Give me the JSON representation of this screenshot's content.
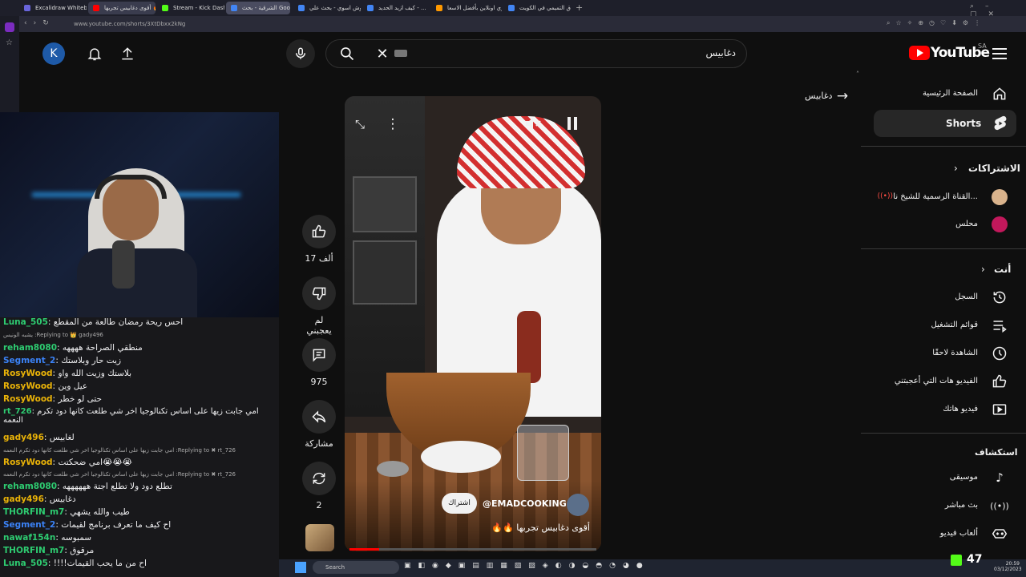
{
  "browser": {
    "tabs": [
      {
        "label": "Excalidraw Whiteboard",
        "color": "#6965db"
      },
      {
        "label": "أقوى دغابيس تجربها 🔥🔥",
        "color": "#ff0000"
      },
      {
        "label": "Stream - Kick Dashboard",
        "color": "#53fc18"
      },
      {
        "label": "الشرقية - بحث Google",
        "color": "#4285f4"
      },
      {
        "label": "وش اسوي - بحث علي",
        "color": "#4285f4"
      },
      {
        "label": "كيف ازيد الحديد - ...",
        "color": "#4285f4"
      },
      {
        "label": "اشتري اونلاين بأفضل الاسعا...",
        "color": "#ff9900"
      },
      {
        "label": "اسواق التميمي في الكويت",
        "color": "#4285f4"
      }
    ],
    "url": "www.youtube.com/shorts/3XtDbxx2kNg"
  },
  "chat": {
    "messages": [
      {
        "user": "Luna_505",
        "text": "احس ريحة رمضان طالعة من المقطع",
        "color": "#2ecc71"
      },
      {
        "reply": "Replying to 👑 gady496: يشبه الونيس"
      },
      {
        "user": "reham8080",
        "text": "منطقي الصراحة ههههه",
        "color": "#2ecc71"
      },
      {
        "user": "Segment_2",
        "text": "زيت حار وبلاستك",
        "color": "#3b82f6"
      },
      {
        "user": "RosyWood",
        "text": "بلاستك وزيت الله واو",
        "color": "#eab308"
      },
      {
        "user": "RosyWood",
        "text": "عيل وين",
        "color": "#eab308"
      },
      {
        "user": "RosyWood",
        "text": "حتى لو خطر",
        "color": "#eab308"
      },
      {
        "user": "rt_726",
        "text": "امي جابت زيها على اساس تكنالوجيا اخر شي طلعت كانها دود تكرم النعمه",
        "color": "#2ecc71"
      },
      {
        "user": "gady496",
        "text": "لغابيس",
        "color": "#eab308"
      },
      {
        "reply": "Replying to ✖ rt_726: امي جابت زيها على اساس تكنالوجيا اخر شي طلعت كانها دود تكرم النعمه"
      },
      {
        "user": "RosyWood",
        "text": "امي ضحكتت😭😭😭",
        "color": "#eab308"
      },
      {
        "reply": "Replying to ✖ rt_726: امي جابت زيها على اساس تكنالوجيا اخر شي طلعت كانها دود تكرم النعمه"
      },
      {
        "user": "reham8080",
        "text": "تطلع دود ولا تطلع اجتة ههههههه",
        "color": "#2ecc71"
      },
      {
        "user": "gady496",
        "text": "دغابيس",
        "color": "#eab308"
      },
      {
        "user": "THORFIN_m7",
        "text": "طيب والله يشهي",
        "color": "#2ecc71"
      },
      {
        "user": "Segment_2",
        "text": "اح كيف ما تعرف برنامج لقيمات",
        "color": "#3b82f6"
      },
      {
        "user": "nawaf154n",
        "text": "سمبوسه",
        "color": "#2ecc71"
      },
      {
        "user": "THORFIN_m7",
        "text": "مرقوق",
        "color": "#2ecc71"
      },
      {
        "user": "Luna_505",
        "text": "!!!!اح من ما يحب القيمات",
        "color": "#2ecc71"
      }
    ]
  },
  "youtube": {
    "logo_text": "YouTube",
    "region": "SA",
    "search_value": "دغابيس",
    "avatar_letter": "K",
    "next_search_label": "دغابيس",
    "sidebar": {
      "home": "الصفحة الرئيسية",
      "shorts": "Shorts",
      "subscriptions_heading": "الاشتراكات",
      "sub1": "القناة الرسمية للشيخ نا...",
      "sub2": "محلس",
      "you_heading": "أنت",
      "history": "السجل",
      "playlists": "قوائم التشغيل",
      "watch_later": "الشاهدة لاحقًا",
      "liked": "الفيديو هات التي أعجبتني",
      "your_videos": "فيديو هاتك",
      "explore_heading": "استكشاف",
      "music": "موسيقى",
      "live": "بث مباشر",
      "gaming": "ألعاب فيديو"
    },
    "actions": {
      "likes": "17 ألف",
      "dislike": "لم يعجبني",
      "comments": "975",
      "share": "مشاركة",
      "remix": "2"
    },
    "video": {
      "channel": "@EMADCOOKING",
      "subscribe": "اشتراك",
      "title": "أقوى دغابيس تجربها 🔥🔥"
    }
  },
  "taskbar": {
    "search": "Search",
    "time": "20:59",
    "date": "03/12/2023",
    "viewers": "47"
  }
}
